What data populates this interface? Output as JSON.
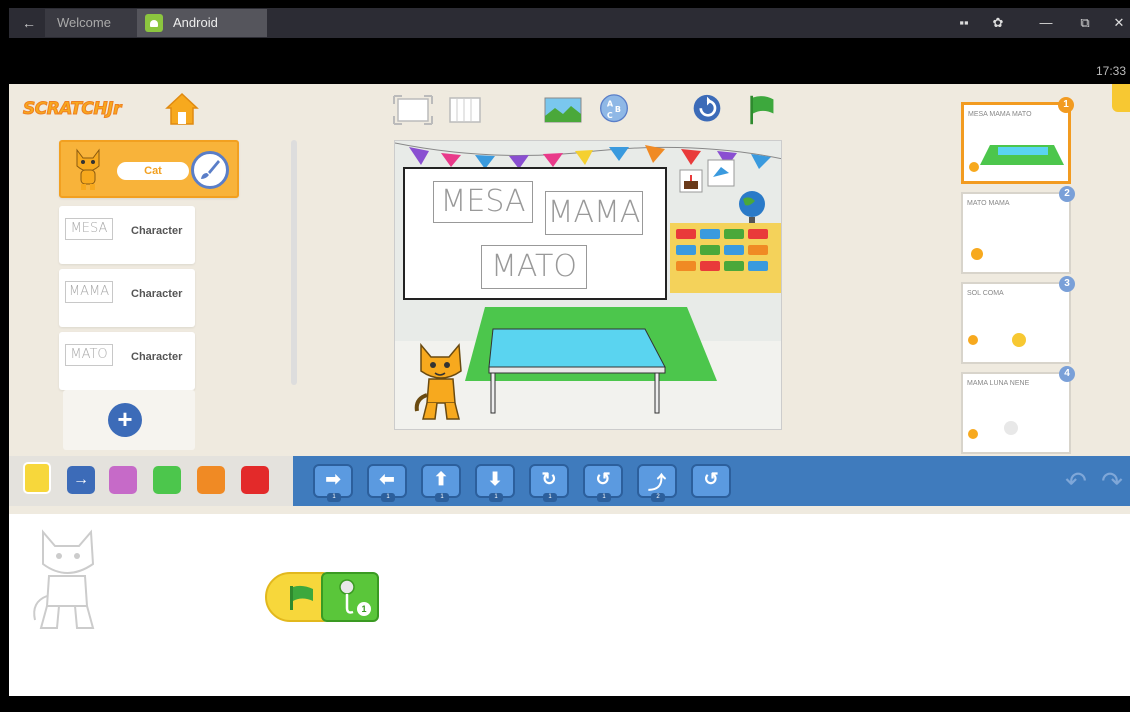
{
  "window": {
    "back_glyph": "←",
    "tabs": [
      {
        "label": "Welcome"
      },
      {
        "label": "Android"
      }
    ],
    "controls": {
      "layout": "▪▪",
      "settings": "✿",
      "minimize": "—",
      "restore": "⧉",
      "close": "✕"
    }
  },
  "status": {
    "clock": "17:33"
  },
  "app": {
    "logo_text": "SCRATCHJr",
    "sprites": [
      {
        "name": "Cat",
        "type": "cat",
        "selected": true
      },
      {
        "name": "Character",
        "thumb": "MESA"
      },
      {
        "name": "Character",
        "thumb": "MAMA"
      },
      {
        "name": "Character",
        "thumb": "MATO"
      }
    ],
    "stage": {
      "words": [
        "MESA",
        "MAMA",
        "MATO"
      ]
    },
    "scenes": [
      {
        "number": "1",
        "words": "MESA MAMA MATO",
        "active": true
      },
      {
        "number": "2",
        "words": "MATO MAMA"
      },
      {
        "number": "3",
        "words": "SOL COMA"
      },
      {
        "number": "4",
        "words": "MAMA LUNA NENE"
      }
    ],
    "palette": {
      "blocks": [
        {
          "icon": "move-right",
          "glyph": "➡",
          "num": "1"
        },
        {
          "icon": "move-left",
          "glyph": "⬅",
          "num": "1"
        },
        {
          "icon": "move-up",
          "glyph": "⬆",
          "num": "1"
        },
        {
          "icon": "move-down",
          "glyph": "⬇",
          "num": "1"
        },
        {
          "icon": "turn-right",
          "glyph": "↻",
          "num": "1"
        },
        {
          "icon": "turn-left",
          "glyph": "↺",
          "num": "1"
        },
        {
          "icon": "hop",
          "glyph": "⤴",
          "num": "2"
        },
        {
          "icon": "go-home",
          "glyph": "↺",
          "num": ""
        }
      ]
    },
    "script": {
      "sound_number": "1"
    }
  },
  "colors": {
    "titlebar": "#2c2c34",
    "app_bg": "#efeadf",
    "palette_bg": "#3f7bbd",
    "selected_sprite": "#f8b33a",
    "trigger_yellow": "#f7d73b",
    "sound_green": "#5ac63a"
  }
}
